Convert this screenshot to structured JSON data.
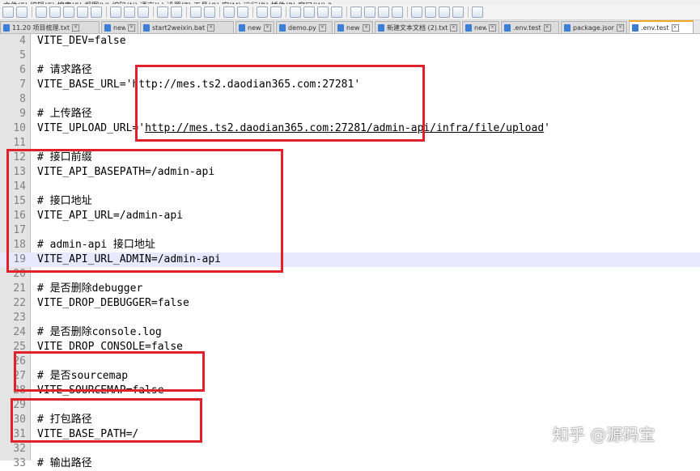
{
  "menubar": {
    "labels": [
      "文件(F)",
      "编辑(E)",
      "搜索(S)",
      "视图(V)",
      "编码(N)",
      "语言(L)",
      "设置(T)",
      "工具(O)",
      "宏(M)",
      "运行(R)",
      "插件(P)",
      "窗口(W)",
      "?"
    ]
  },
  "toolbar": {
    "icons": [
      "new-icon",
      "open-icon",
      "save-icon",
      "save-all-icon",
      "close-icon",
      "close-all-icon",
      "print-icon",
      "cut-icon",
      "copy-icon",
      "paste-icon",
      "undo-icon",
      "redo-icon",
      "find-icon",
      "replace-icon",
      "zoom-in-icon",
      "zoom-out-icon",
      "sync-v-icon",
      "sync-h-icon",
      "wrap-icon",
      "all-chars-icon",
      "indent-guide-icon",
      "udl-icon",
      "doc-map-icon",
      "func-list-icon",
      "folder-workspace-icon",
      "monitor-icon",
      "record-icon",
      "stop-icon",
      "play-icon",
      "play-multi-icon",
      "save-macro-icon"
    ]
  },
  "tabs": [
    {
      "label": "11.20 项目梳理.txt",
      "active": false
    },
    {
      "label": "new 17",
      "active": false
    },
    {
      "label": "start2weixin.bat",
      "active": false
    },
    {
      "label": "new 28",
      "active": false
    },
    {
      "label": "demo.py",
      "active": false
    },
    {
      "label": "new 29",
      "active": false
    },
    {
      "label": "新建文本文档 (2).txt",
      "active": false
    },
    {
      "label": "new 5",
      "active": false
    },
    {
      "label": ".env.test",
      "active": false
    },
    {
      "label": "package.json",
      "active": false
    },
    {
      "label": ".env.test",
      "active": true
    }
  ],
  "editor": {
    "lines": [
      {
        "num": "4",
        "text": "VITE_DEV=false"
      },
      {
        "num": "5",
        "text": ""
      },
      {
        "num": "6",
        "text": "# 请求路径"
      },
      {
        "num": "7",
        "text": "VITE_BASE_URL='http://mes.ts2.daodian365.com:27281'"
      },
      {
        "num": "8",
        "text": ""
      },
      {
        "num": "9",
        "text": "# 上传路径"
      },
      {
        "num": "10",
        "text": "VITE_UPLOAD_URL='http://mes.ts2.daodian365.com:27281/admin-api/infra/file/upload'"
      },
      {
        "num": "11",
        "text": ""
      },
      {
        "num": "12",
        "text": "# 接口前缀"
      },
      {
        "num": "13",
        "text": "VITE_API_BASEPATH=/admin-api"
      },
      {
        "num": "14",
        "text": ""
      },
      {
        "num": "15",
        "text": "# 接口地址"
      },
      {
        "num": "16",
        "text": "VITE_API_URL=/admin-api"
      },
      {
        "num": "17",
        "text": ""
      },
      {
        "num": "18",
        "text": "# admin-api 接口地址"
      },
      {
        "num": "19",
        "text": "VITE_API_URL_ADMIN=/admin-api"
      },
      {
        "num": "20",
        "text": ""
      },
      {
        "num": "21",
        "text": "# 是否删除debugger"
      },
      {
        "num": "22",
        "text": "VITE_DROP_DEBUGGER=false"
      },
      {
        "num": "23",
        "text": ""
      },
      {
        "num": "24",
        "text": "# 是否删除console.log"
      },
      {
        "num": "25",
        "text": "VITE_DROP_CONSOLE=false"
      },
      {
        "num": "26",
        "text": ""
      },
      {
        "num": "27",
        "text": "# 是否sourcemap"
      },
      {
        "num": "28",
        "text": "VITE_SOURCEMAP=false"
      },
      {
        "num": "29",
        "text": ""
      },
      {
        "num": "30",
        "text": "# 打包路径"
      },
      {
        "num": "31",
        "text": "VITE_BASE_PATH=/"
      },
      {
        "num": "32",
        "text": ""
      },
      {
        "num": "33",
        "text": "# 输出路径"
      }
    ]
  },
  "watermark": "知乎 @源码宝"
}
